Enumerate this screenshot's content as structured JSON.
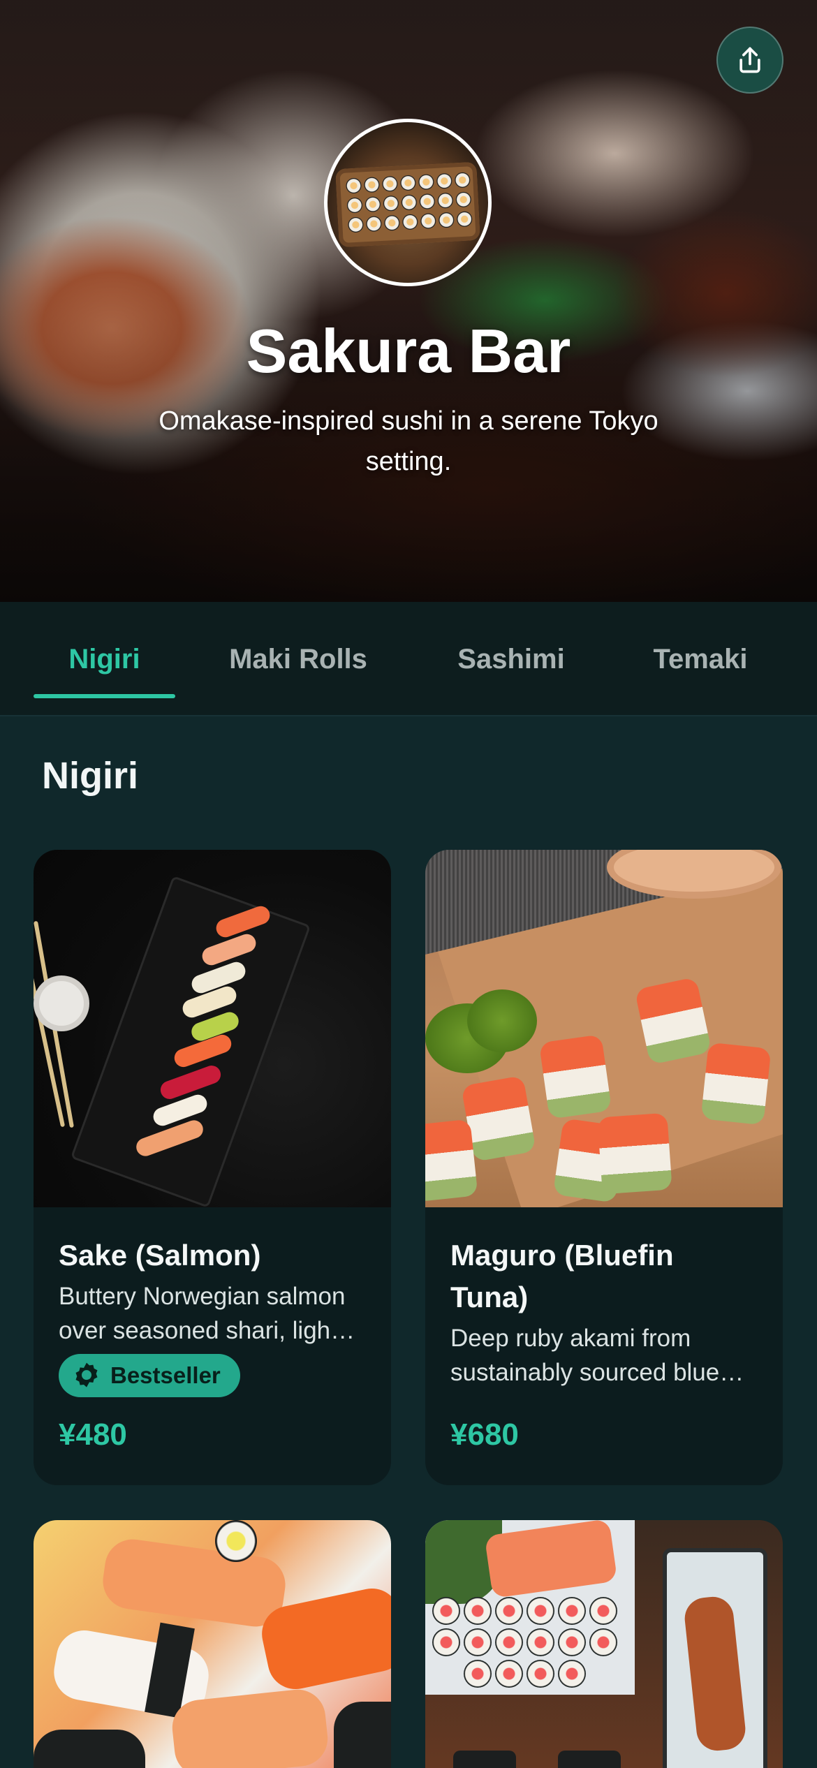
{
  "hero": {
    "title": "Sakura Bar",
    "subtitle": "Omakase-inspired sushi in a serene Tokyo setting.",
    "share_icon": "share-icon"
  },
  "tabs": [
    {
      "label": "Nigiri",
      "active": true
    },
    {
      "label": "Maki Rolls",
      "active": false
    },
    {
      "label": "Sashimi",
      "active": false
    },
    {
      "label": "Temaki",
      "active": false
    }
  ],
  "section": {
    "title": "Nigiri"
  },
  "items": [
    {
      "name": "Sake (Salmon)",
      "description": "Buttery Norwegian salmon over seasoned shari, ligh…",
      "badge": "Bestseller",
      "price": "¥480"
    },
    {
      "name": "Maguro (Bluefin Tuna)",
      "description": "Deep ruby akami from sustainably sourced blue…",
      "badge": "",
      "price": "¥680"
    },
    {
      "name": "",
      "description": "",
      "badge": "",
      "price": ""
    },
    {
      "name": "",
      "description": "",
      "badge": "",
      "price": ""
    }
  ],
  "colors": {
    "accent": "#2ec7a4",
    "background": "#10282b",
    "tab_bar": "#0d1d1e",
    "card": "#0c1c1e",
    "badge": "#23a88c"
  }
}
